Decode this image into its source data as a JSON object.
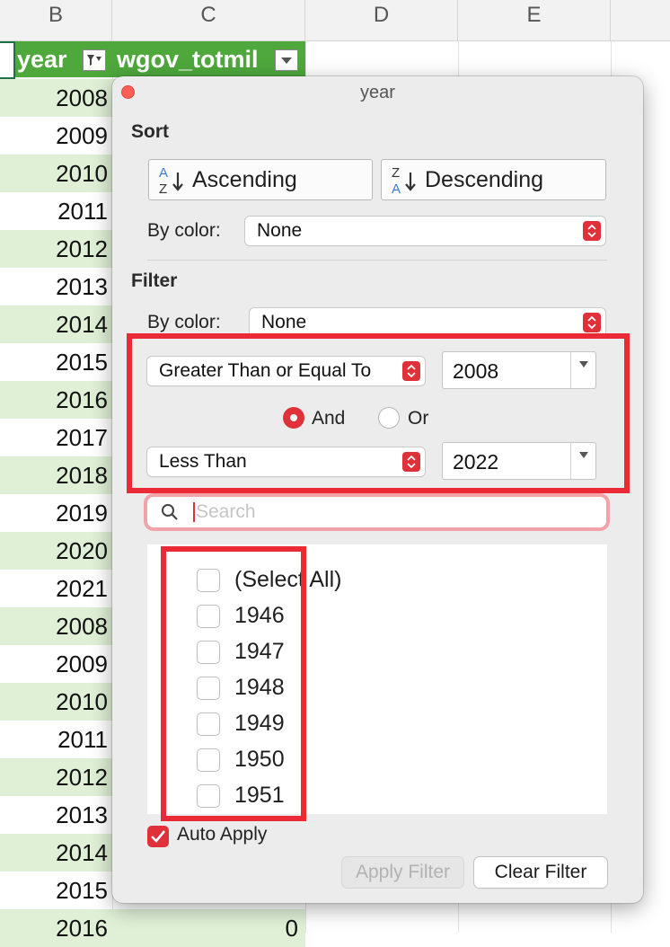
{
  "sheet": {
    "columns": [
      "B",
      "C",
      "D",
      "E"
    ],
    "header_cells": {
      "year": "year",
      "wgov": "wgov_totmil"
    },
    "year_rows": [
      "2008",
      "2009",
      "2010",
      "2011",
      "2012",
      "2013",
      "2014",
      "2015",
      "2016",
      "2017",
      "2018",
      "2019",
      "2020",
      "2021",
      "2008",
      "2009",
      "2010",
      "2011",
      "2012",
      "2013",
      "2014",
      "2015",
      "2016"
    ],
    "last_row_c_value": "0",
    "colors": {
      "header_green": "#4ea83c",
      "band_green": "#dff0d6"
    }
  },
  "dialog": {
    "title": "year",
    "sort": {
      "heading": "Sort",
      "ascending_label": "Ascending",
      "descending_label": "Descending",
      "by_color_label": "By color:",
      "by_color_value": "None",
      "az_icon": {
        "top": "A",
        "bottom": "Z"
      },
      "za_icon": {
        "top": "Z",
        "bottom": "A"
      }
    },
    "filter": {
      "heading": "Filter",
      "by_color_label": "By color:",
      "by_color_value": "None",
      "condition1": {
        "operator": "Greater Than or Equal To",
        "value": "2008"
      },
      "logic": {
        "and_label": "And",
        "or_label": "Or",
        "selected": "And"
      },
      "condition2": {
        "operator": "Less Than",
        "value": "2022"
      }
    },
    "search": {
      "placeholder": "Search",
      "value": ""
    },
    "list": {
      "items": [
        "(Select All)",
        "1946",
        "1947",
        "1948",
        "1949",
        "1950",
        "1951"
      ],
      "checked": [
        false,
        false,
        false,
        false,
        false,
        false,
        false
      ]
    },
    "auto_apply": {
      "label": "Auto Apply",
      "checked": true
    },
    "buttons": {
      "apply_label": "Apply Filter",
      "apply_enabled": false,
      "clear_label": "Clear Filter"
    },
    "accent_color": "#e0303a",
    "highlight_color": "#ea2b36"
  }
}
